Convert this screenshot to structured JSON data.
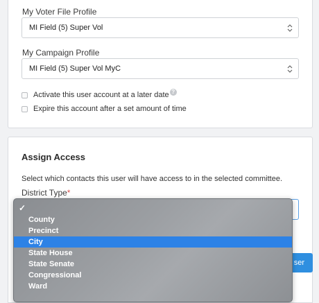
{
  "voter_profile": {
    "label": "My Voter File Profile",
    "value": "MI Field (5) Super Vol"
  },
  "campaign_profile": {
    "label": "My Campaign Profile",
    "value": "MI Field (5) Super Vol MyC"
  },
  "options": {
    "activate_later": "Activate this user account at a later date",
    "expire_account": "Expire this account after a set amount of time",
    "help_glyph": "?"
  },
  "assign_access": {
    "title": "Assign Access",
    "description": "Select which contacts this user will have access to in the selected committee.",
    "district_type_label": "District Type",
    "required_mark": "*"
  },
  "save_button": {
    "label": "ser"
  },
  "dropdown": {
    "check_glyph": "✓",
    "items": [
      "",
      "County",
      "Precinct",
      "City",
      "State House",
      "State Senate",
      "Congressional",
      "Ward"
    ],
    "highlighted": "City"
  },
  "colors": {
    "accent": "#2f8fe0",
    "highlight": "#2d82e6",
    "required": "#d9534f"
  }
}
